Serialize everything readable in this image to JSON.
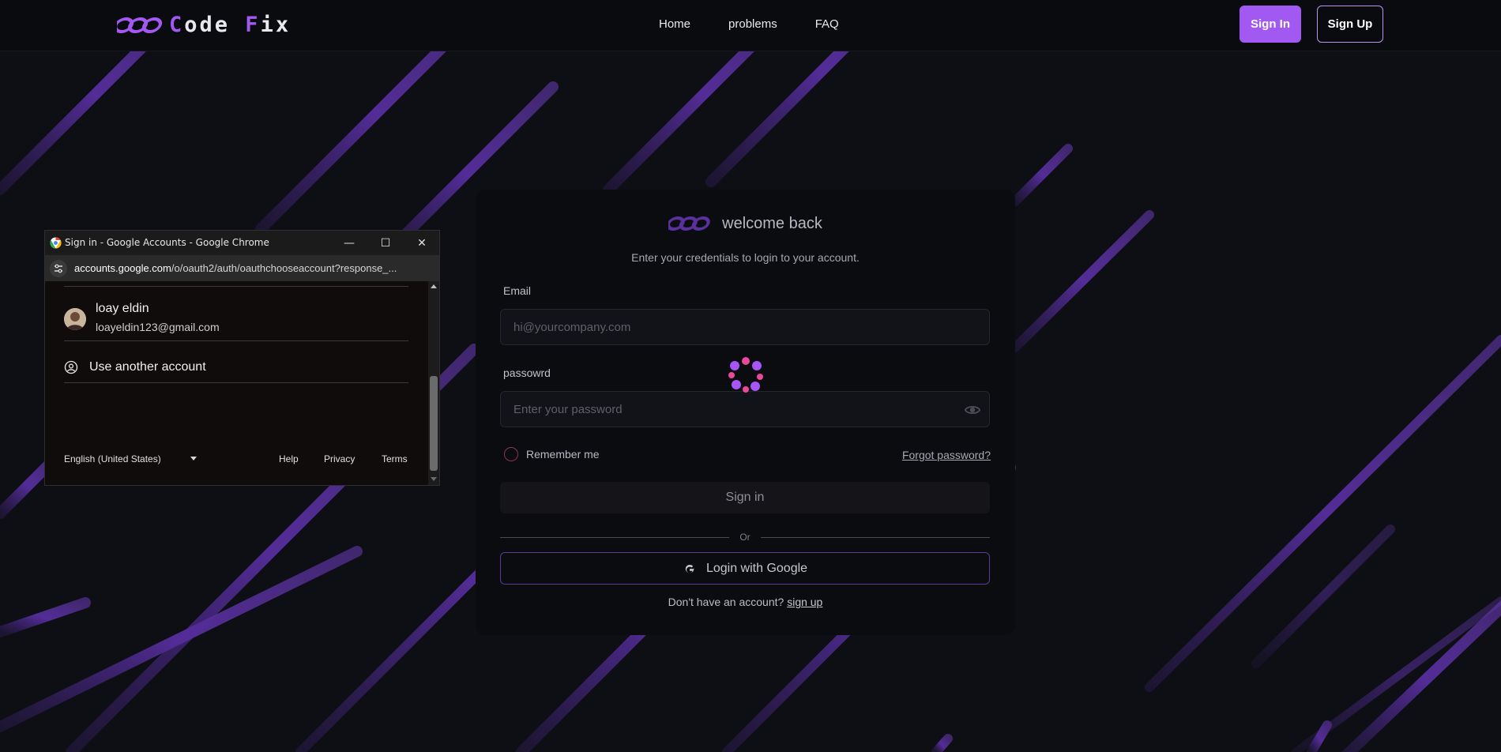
{
  "colors": {
    "accent": "#a259f2",
    "background": "#0d0f14",
    "card": "#0b0c10",
    "streak": "#5a2f9e"
  },
  "navbar": {
    "logo_first": "C",
    "logo_rest_1": "ode ",
    "logo_accent_2": "F",
    "logo_rest_2": "ix",
    "links": [
      "Home",
      "problems",
      "FAQ"
    ],
    "signin_label": "Sign In",
    "signup_label": "Sign Up"
  },
  "login": {
    "title": "welcome back",
    "subtitle": "Enter your credentials to login to your account.",
    "email_label": "Email",
    "email_placeholder": "hi@yourcompany.com",
    "password_label": "passowrd",
    "password_placeholder": "Enter your password",
    "remember_label": "Remember me",
    "forgot_label": "Forgot password?",
    "signin_label": "Sign in",
    "or_label": "Or",
    "google_label": "Login with Google",
    "no_account_text": "Don't have an account?",
    "signup_link": "sign up"
  },
  "popup": {
    "window_title": "Sign in - Google Accounts - Google Chrome",
    "url_host": "accounts.google.com",
    "url_path": "/o/oauth2/auth/oauthchooseaccount?response_...",
    "account_name": "loay eldin",
    "account_email": "loayeldin123@gmail.com",
    "another_account": "Use another account",
    "language": "English (United States)",
    "help": "Help",
    "privacy": "Privacy",
    "terms": "Terms"
  }
}
